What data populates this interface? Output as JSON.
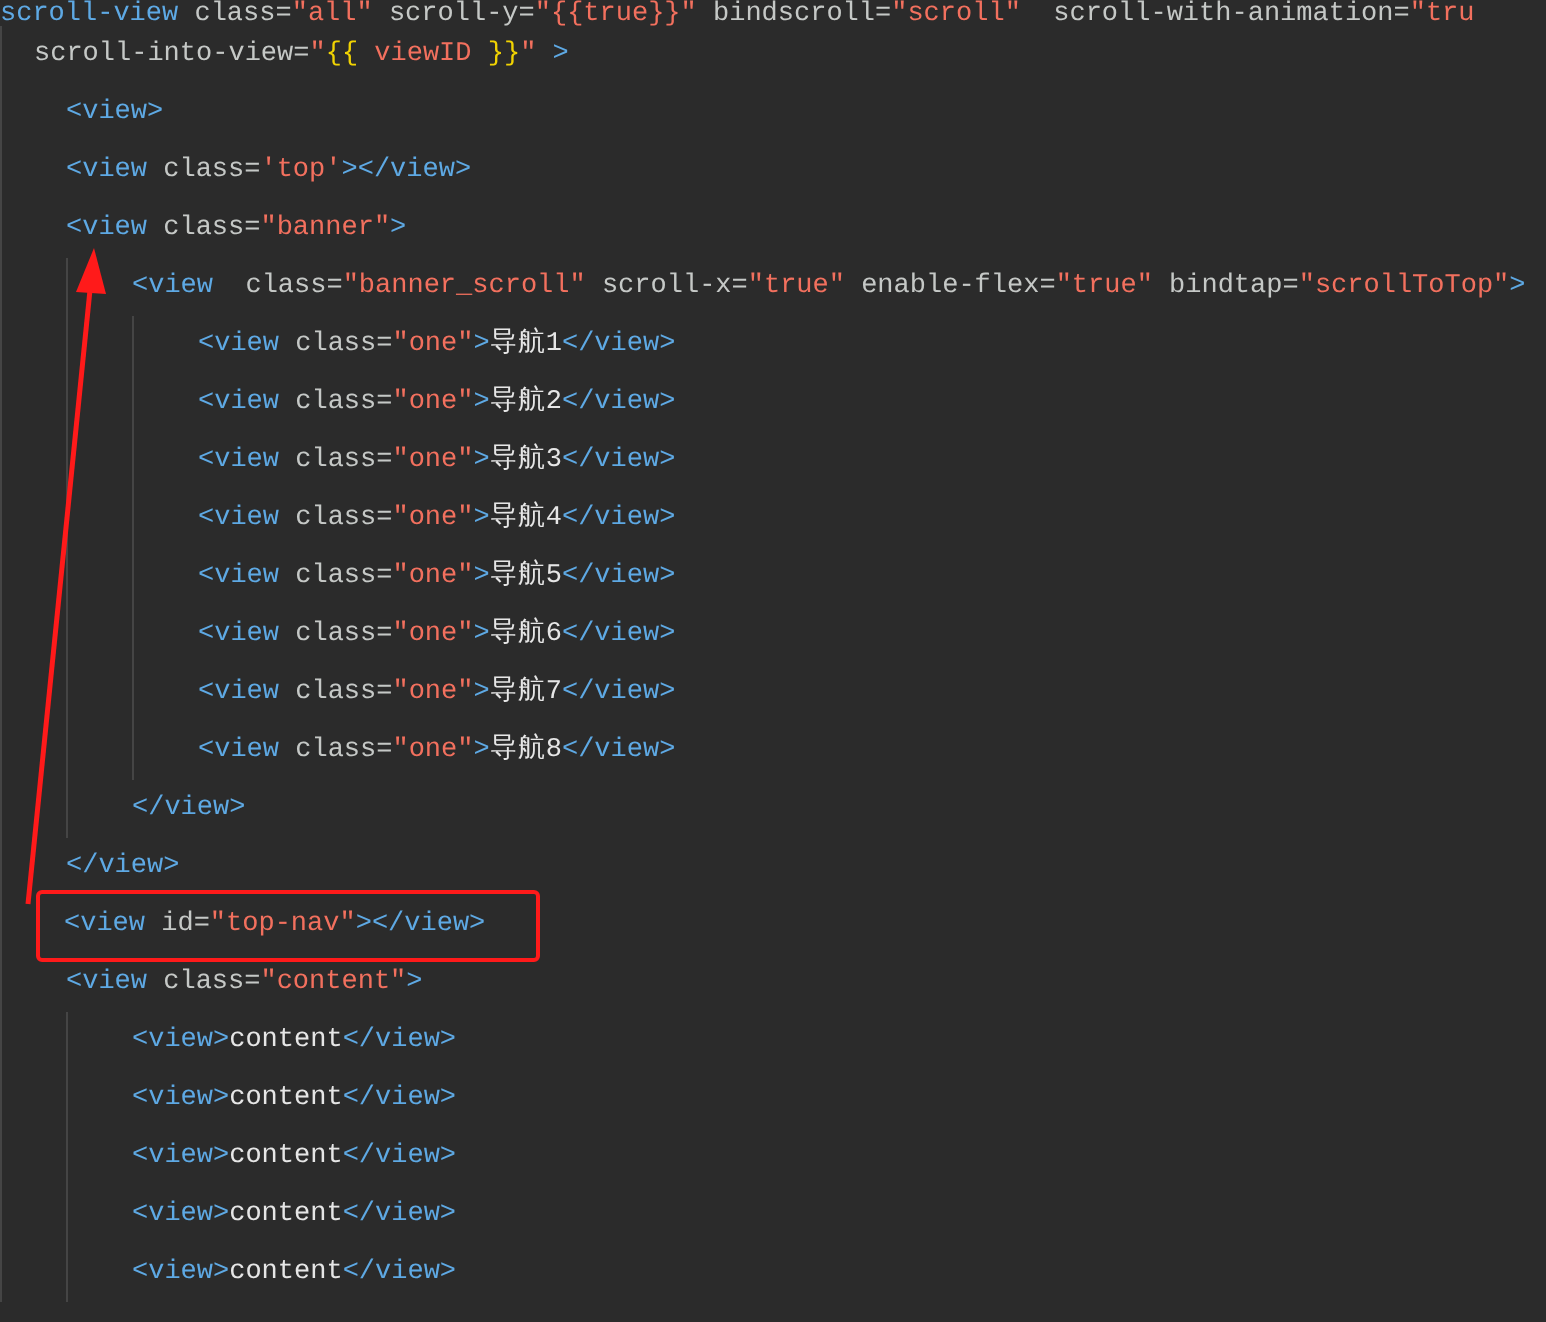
{
  "editor": {
    "lines": [
      {
        "tokens": [
          {
            "kind": "tag",
            "text": "scroll-view"
          },
          {
            "kind": "attr",
            "text": " class="
          },
          {
            "kind": "string",
            "text": "\"all\""
          },
          {
            "kind": "attr",
            "text": " scroll-y="
          },
          {
            "kind": "string",
            "text": "\"{{true}}\""
          },
          {
            "kind": "attr",
            "text": " bindscroll="
          },
          {
            "kind": "string",
            "text": "\"scroll\""
          },
          {
            "kind": "attr",
            "text": "  scroll-with-animation="
          },
          {
            "kind": "string",
            "text": "\"tru"
          }
        ],
        "children": [
          {
            "wrapped": true,
            "tokens": [
              {
                "kind": "attr",
                "text": "scroll-into-view="
              },
              {
                "kind": "string",
                "text": "\""
              },
              {
                "kind": "brace",
                "text": "{{"
              },
              {
                "kind": "string",
                "text": " viewID "
              },
              {
                "kind": "brace",
                "text": "}}"
              },
              {
                "kind": "string",
                "text": "\""
              },
              {
                "kind": "tag",
                "text": " >"
              }
            ]
          },
          {
            "tokens": [
              {
                "kind": "tag",
                "text": "<view>"
              }
            ]
          },
          {
            "tokens": [
              {
                "kind": "tag",
                "text": "<view"
              },
              {
                "kind": "attr",
                "text": " class="
              },
              {
                "kind": "string",
                "text": "'top'"
              },
              {
                "kind": "tag",
                "text": "></view>"
              }
            ]
          },
          {
            "tokens": [
              {
                "kind": "tag",
                "text": "<view"
              },
              {
                "kind": "attr",
                "text": " class="
              },
              {
                "kind": "string",
                "text": "\"banner\""
              },
              {
                "kind": "tag",
                "text": ">"
              }
            ],
            "children": [
              {
                "tokens": [
                  {
                    "kind": "tag",
                    "text": "<view"
                  },
                  {
                    "kind": "attr",
                    "text": "  class="
                  },
                  {
                    "kind": "string",
                    "text": "\"banner_scroll\""
                  },
                  {
                    "kind": "attr",
                    "text": " scroll-x="
                  },
                  {
                    "kind": "string",
                    "text": "\"true\""
                  },
                  {
                    "kind": "attr",
                    "text": " enable-flex="
                  },
                  {
                    "kind": "string",
                    "text": "\"true\""
                  },
                  {
                    "kind": "attr",
                    "text": " bindtap="
                  },
                  {
                    "kind": "string",
                    "text": "\"scrollToTop\""
                  },
                  {
                    "kind": "tag",
                    "text": ">"
                  }
                ],
                "children": [
                  {
                    "tokens": [
                      {
                        "kind": "tag",
                        "text": "<view"
                      },
                      {
                        "kind": "attr",
                        "text": " class="
                      },
                      {
                        "kind": "string",
                        "text": "\"one\""
                      },
                      {
                        "kind": "tag",
                        "text": ">"
                      },
                      {
                        "kind": "text",
                        "text": "导航1"
                      },
                      {
                        "kind": "tag",
                        "text": "</view>"
                      }
                    ]
                  },
                  {
                    "tokens": [
                      {
                        "kind": "tag",
                        "text": "<view"
                      },
                      {
                        "kind": "attr",
                        "text": " class="
                      },
                      {
                        "kind": "string",
                        "text": "\"one\""
                      },
                      {
                        "kind": "tag",
                        "text": ">"
                      },
                      {
                        "kind": "text",
                        "text": "导航2"
                      },
                      {
                        "kind": "tag",
                        "text": "</view>"
                      }
                    ]
                  },
                  {
                    "tokens": [
                      {
                        "kind": "tag",
                        "text": "<view"
                      },
                      {
                        "kind": "attr",
                        "text": " class="
                      },
                      {
                        "kind": "string",
                        "text": "\"one\""
                      },
                      {
                        "kind": "tag",
                        "text": ">"
                      },
                      {
                        "kind": "text",
                        "text": "导航3"
                      },
                      {
                        "kind": "tag",
                        "text": "</view>"
                      }
                    ]
                  },
                  {
                    "tokens": [
                      {
                        "kind": "tag",
                        "text": "<view"
                      },
                      {
                        "kind": "attr",
                        "text": " class="
                      },
                      {
                        "kind": "string",
                        "text": "\"one\""
                      },
                      {
                        "kind": "tag",
                        "text": ">"
                      },
                      {
                        "kind": "text",
                        "text": "导航4"
                      },
                      {
                        "kind": "tag",
                        "text": "</view>"
                      }
                    ]
                  },
                  {
                    "tokens": [
                      {
                        "kind": "tag",
                        "text": "<view"
                      },
                      {
                        "kind": "attr",
                        "text": " class="
                      },
                      {
                        "kind": "string",
                        "text": "\"one\""
                      },
                      {
                        "kind": "tag",
                        "text": ">"
                      },
                      {
                        "kind": "text",
                        "text": "导航5"
                      },
                      {
                        "kind": "tag",
                        "text": "</view>"
                      }
                    ]
                  },
                  {
                    "tokens": [
                      {
                        "kind": "tag",
                        "text": "<view"
                      },
                      {
                        "kind": "attr",
                        "text": " class="
                      },
                      {
                        "kind": "string",
                        "text": "\"one\""
                      },
                      {
                        "kind": "tag",
                        "text": ">"
                      },
                      {
                        "kind": "text",
                        "text": "导航6"
                      },
                      {
                        "kind": "tag",
                        "text": "</view>"
                      }
                    ]
                  },
                  {
                    "tokens": [
                      {
                        "kind": "tag",
                        "text": "<view"
                      },
                      {
                        "kind": "attr",
                        "text": " class="
                      },
                      {
                        "kind": "string",
                        "text": "\"one\""
                      },
                      {
                        "kind": "tag",
                        "text": ">"
                      },
                      {
                        "kind": "text",
                        "text": "导航7"
                      },
                      {
                        "kind": "tag",
                        "text": "</view>"
                      }
                    ]
                  },
                  {
                    "tokens": [
                      {
                        "kind": "tag",
                        "text": "<view"
                      },
                      {
                        "kind": "attr",
                        "text": " class="
                      },
                      {
                        "kind": "string",
                        "text": "\"one\""
                      },
                      {
                        "kind": "tag",
                        "text": ">"
                      },
                      {
                        "kind": "text",
                        "text": "导航8"
                      },
                      {
                        "kind": "tag",
                        "text": "</view>"
                      }
                    ]
                  }
                ]
              },
              {
                "tokens": [
                  {
                    "kind": "tag",
                    "text": "</view>"
                  }
                ]
              }
            ]
          },
          {
            "tokens": [
              {
                "kind": "tag",
                "text": "</view>"
              }
            ]
          },
          {
            "highlighted": true,
            "tokens": [
              {
                "kind": "tag",
                "text": "<view"
              },
              {
                "kind": "attr",
                "text": " id="
              },
              {
                "kind": "string",
                "text": "\"top-nav\""
              },
              {
                "kind": "tag",
                "text": "></view>"
              }
            ]
          },
          {
            "tokens": [
              {
                "kind": "tag",
                "text": "<view"
              },
              {
                "kind": "attr",
                "text": " class="
              },
              {
                "kind": "string",
                "text": "\"content\""
              },
              {
                "kind": "tag",
                "text": ">"
              }
            ],
            "children": [
              {
                "tokens": [
                  {
                    "kind": "tag",
                    "text": "<view>"
                  },
                  {
                    "kind": "text",
                    "text": "content"
                  },
                  {
                    "kind": "tag",
                    "text": "</view>"
                  }
                ]
              },
              {
                "tokens": [
                  {
                    "kind": "tag",
                    "text": "<view>"
                  },
                  {
                    "kind": "text",
                    "text": "content"
                  },
                  {
                    "kind": "tag",
                    "text": "</view>"
                  }
                ]
              },
              {
                "tokens": [
                  {
                    "kind": "tag",
                    "text": "<view>"
                  },
                  {
                    "kind": "text",
                    "text": "content"
                  },
                  {
                    "kind": "tag",
                    "text": "</view>"
                  }
                ]
              },
              {
                "tokens": [
                  {
                    "kind": "tag",
                    "text": "<view>"
                  },
                  {
                    "kind": "text",
                    "text": "content"
                  },
                  {
                    "kind": "tag",
                    "text": "</view>"
                  }
                ]
              },
              {
                "tokens": [
                  {
                    "kind": "tag",
                    "text": "<view>"
                  },
                  {
                    "kind": "text",
                    "text": "content"
                  },
                  {
                    "kind": "tag",
                    "text": "</view>"
                  }
                ]
              }
            ]
          }
        ]
      }
    ]
  }
}
